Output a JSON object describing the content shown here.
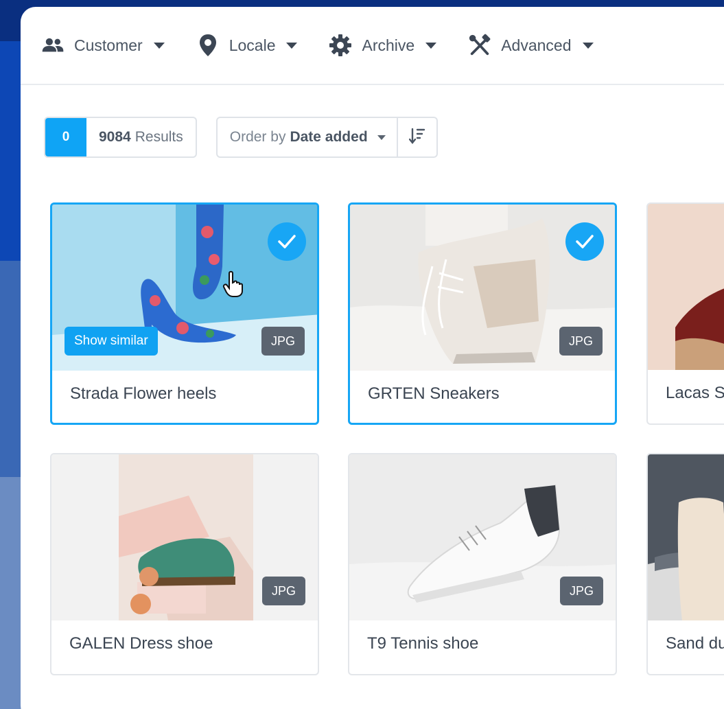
{
  "filters": [
    {
      "label": "Customer",
      "icon": "people-icon"
    },
    {
      "label": "Locale",
      "icon": "location-pin-icon"
    },
    {
      "label": "Archive",
      "icon": "gear-icon"
    },
    {
      "label": "Advanced",
      "icon": "tools-icon"
    }
  ],
  "toolbar": {
    "selected_count": "0",
    "results_count": "9084",
    "results_label": "Results",
    "order_prefix": "Order by",
    "order_value": "Date added"
  },
  "cards": [
    {
      "title": "Strada Flower heels",
      "badge": "JPG",
      "selected": true,
      "show_similar": "Show similar"
    },
    {
      "title": "GRTEN Sneakers",
      "badge": "JPG",
      "selected": true
    },
    {
      "title": "Lacas S",
      "badge": "",
      "selected": false
    },
    {
      "title": "GALEN Dress shoe",
      "badge": "JPG",
      "selected": false
    },
    {
      "title": "T9 Tennis shoe",
      "badge": "JPG",
      "selected": false
    },
    {
      "title": "Sand du",
      "badge": "",
      "selected": false
    }
  ],
  "colors": {
    "accent": "#16a6f5",
    "badge": "#5b6470",
    "text": "#3b4552"
  }
}
